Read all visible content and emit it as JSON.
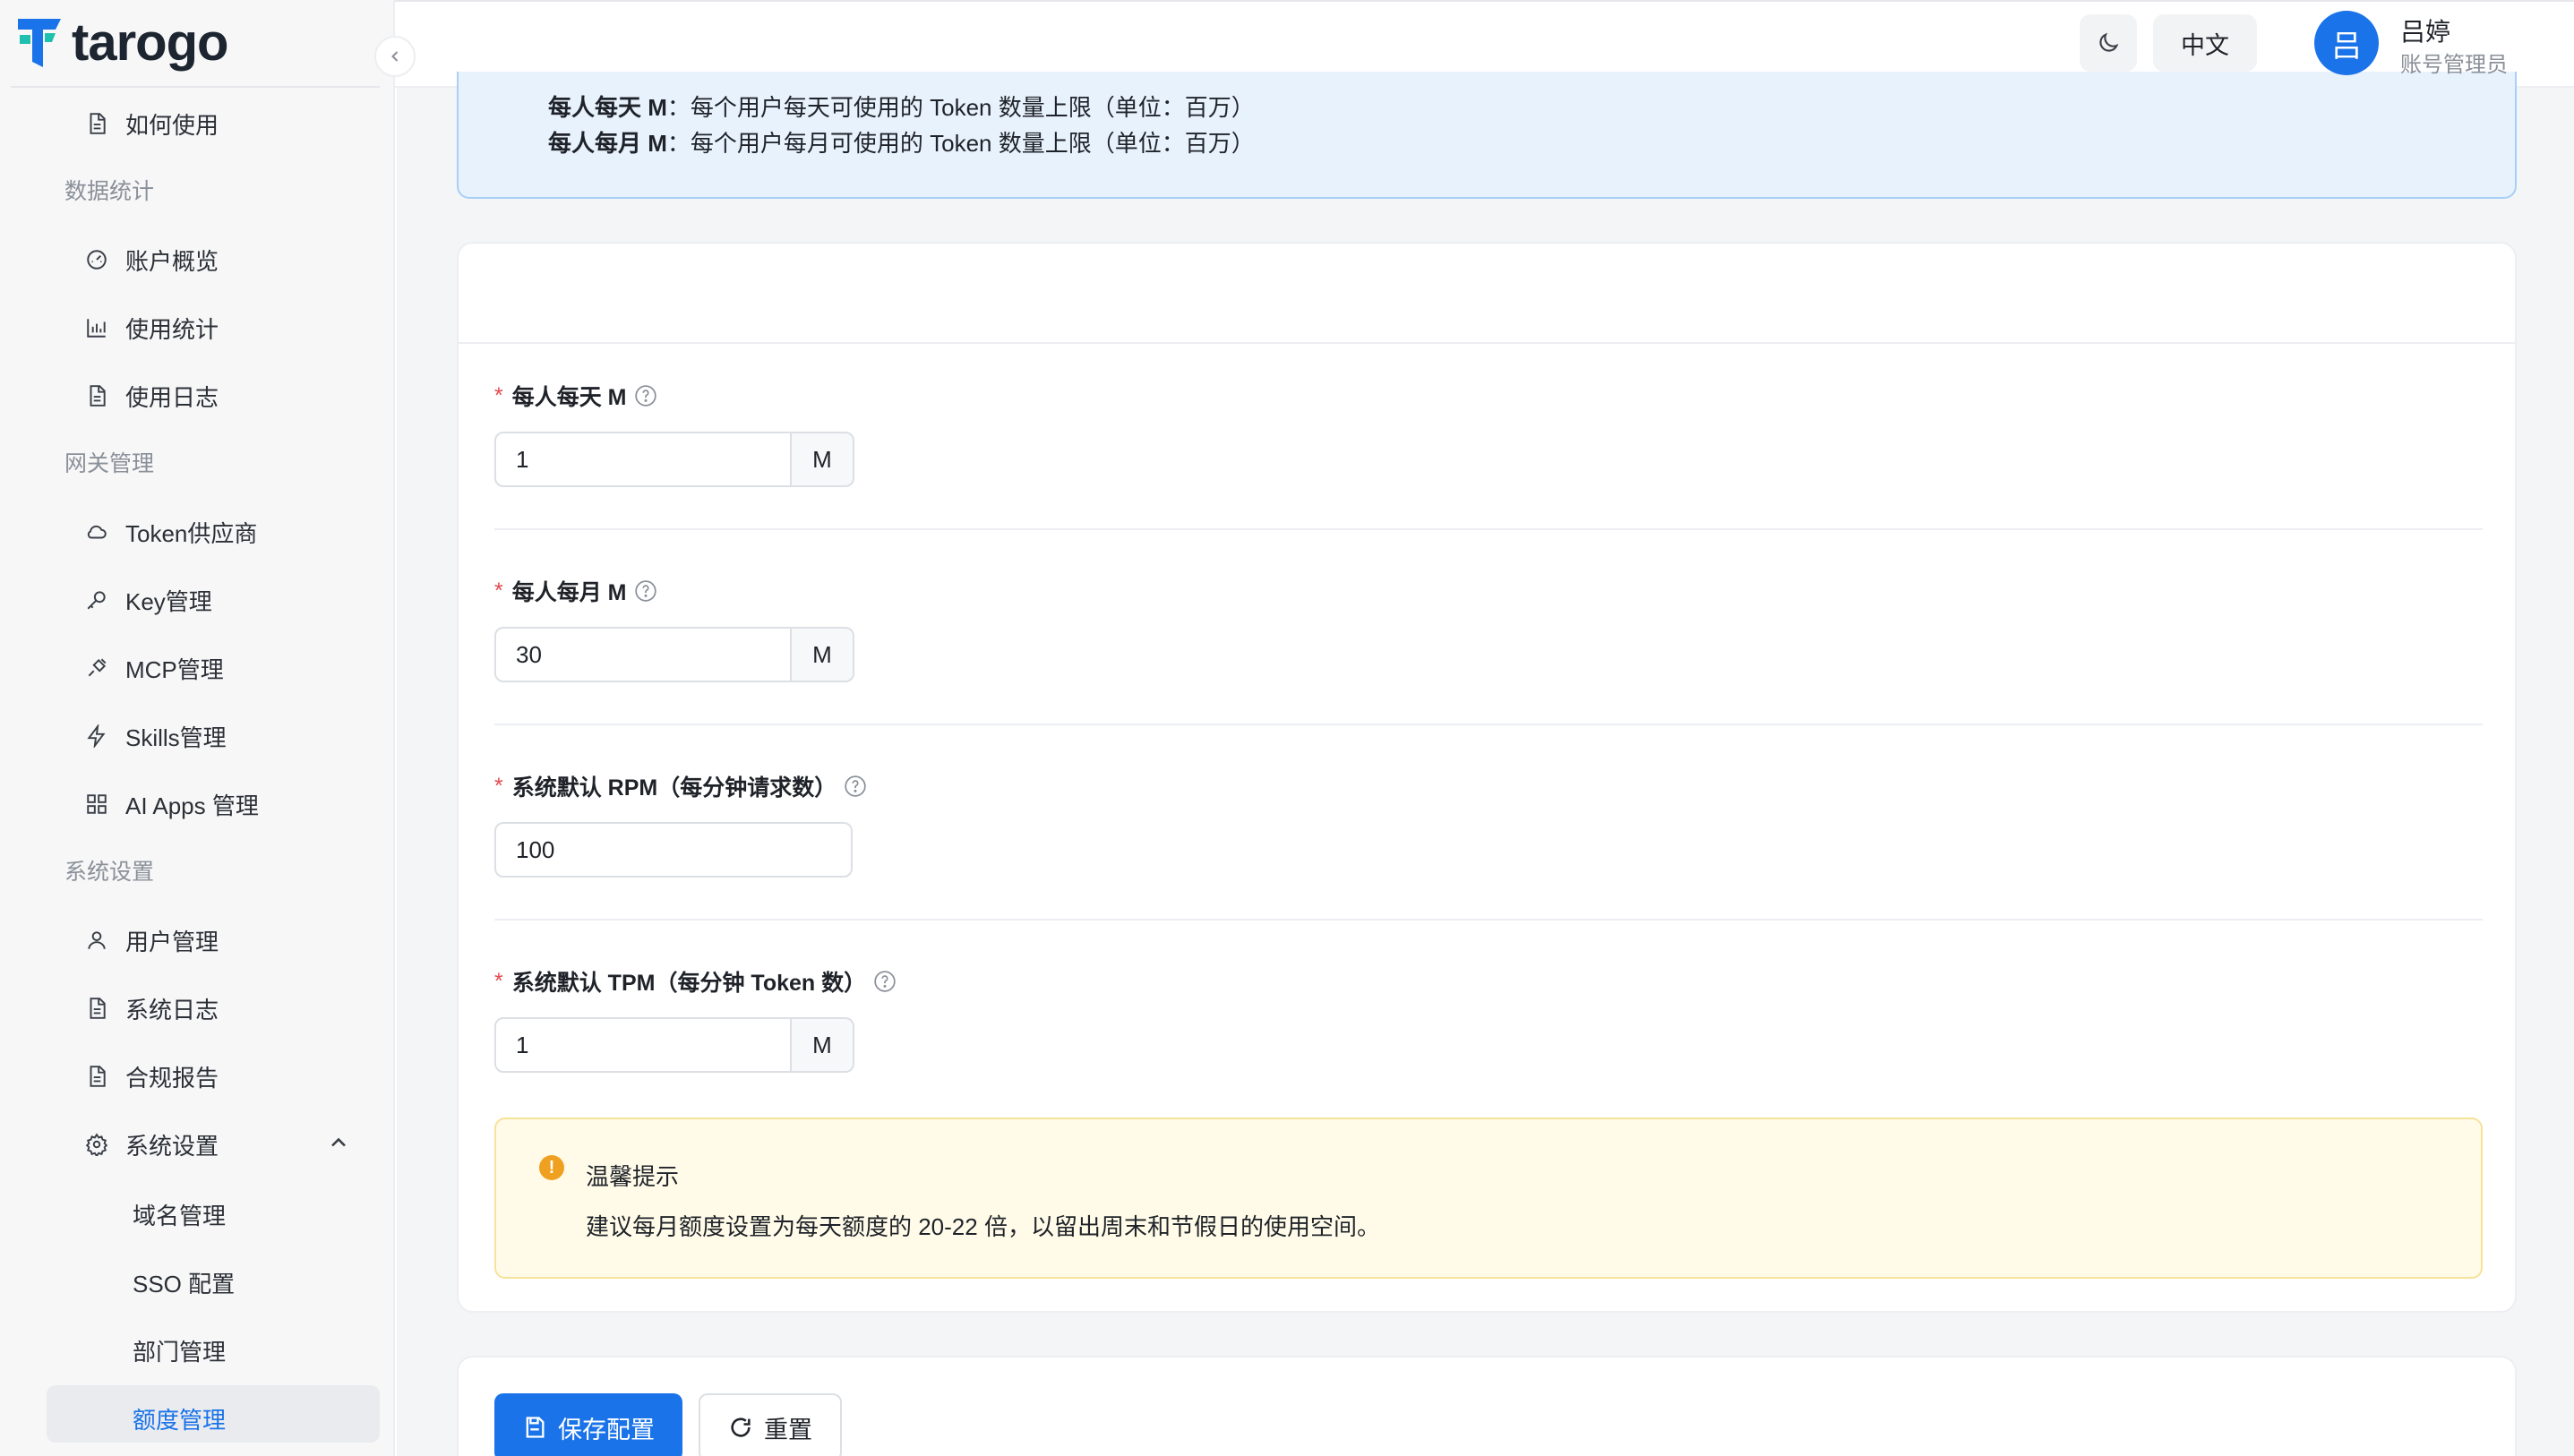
{
  "app": {
    "name": "tarogo"
  },
  "sidebar": {
    "top_item": {
      "label": "如何使用",
      "icon": "doc-icon"
    },
    "sections": [
      {
        "title": "数据统计",
        "items": [
          {
            "label": "账户概览",
            "icon": "dashboard-icon"
          },
          {
            "label": "使用统计",
            "icon": "bar-chart-icon"
          },
          {
            "label": "使用日志",
            "icon": "doc-icon"
          }
        ]
      },
      {
        "title": "网关管理",
        "items": [
          {
            "label": "Token供应商",
            "icon": "cloud-icon"
          },
          {
            "label": "Key管理",
            "icon": "key-icon"
          },
          {
            "label": "MCP管理",
            "icon": "plug-icon"
          },
          {
            "label": "Skills管理",
            "icon": "bolt-icon"
          },
          {
            "label": "AI Apps 管理",
            "icon": "grid-icon"
          }
        ]
      },
      {
        "title": "系统设置",
        "items": [
          {
            "label": "用户管理",
            "icon": "user-icon"
          },
          {
            "label": "系统日志",
            "icon": "doc-icon"
          },
          {
            "label": "合规报告",
            "icon": "doc-icon"
          },
          {
            "label": "系统设置",
            "icon": "gear-icon",
            "expanded": true
          }
        ]
      }
    ],
    "sub_items": [
      "域名管理",
      "SSO 配置",
      "部门管理",
      "额度管理"
    ],
    "active_sub_item": "额度管理"
  },
  "header": {
    "language": "中文",
    "user": {
      "avatar_text": "吕",
      "name": "吕婷",
      "role": "账号管理员"
    }
  },
  "info": {
    "lines": [
      {
        "term": "每人每天 M",
        "desc": "：每个用户每天可使用的 Token 数量上限（单位：百万）"
      },
      {
        "term": "每人每月 M",
        "desc": "：每个用户每月可使用的 Token 数量上限（单位：百万）"
      }
    ]
  },
  "form": {
    "fields": [
      {
        "label": "每人每天 M",
        "value": "1",
        "addon": "M",
        "required": true
      },
      {
        "label": "每人每月 M",
        "value": "30",
        "addon": "M",
        "required": true
      },
      {
        "label": "系统默认 RPM（每分钟请求数）",
        "value": "100",
        "addon": "",
        "required": true
      },
      {
        "label": "系统默认 TPM（每分钟 Token 数）",
        "value": "1",
        "addon": "M",
        "required": true
      }
    ],
    "required_mark": "*"
  },
  "tip": {
    "title": "温馨提示",
    "text": "建议每月额度设置为每天额度的 20-22 倍，以留出周末和节假日的使用空间。",
    "icon_text": "!"
  },
  "actions": {
    "save": "保存配置",
    "reset": "重置"
  },
  "colors": {
    "primary": "#1a73e8",
    "warning": "#f0a020",
    "danger": "#e5484d"
  }
}
